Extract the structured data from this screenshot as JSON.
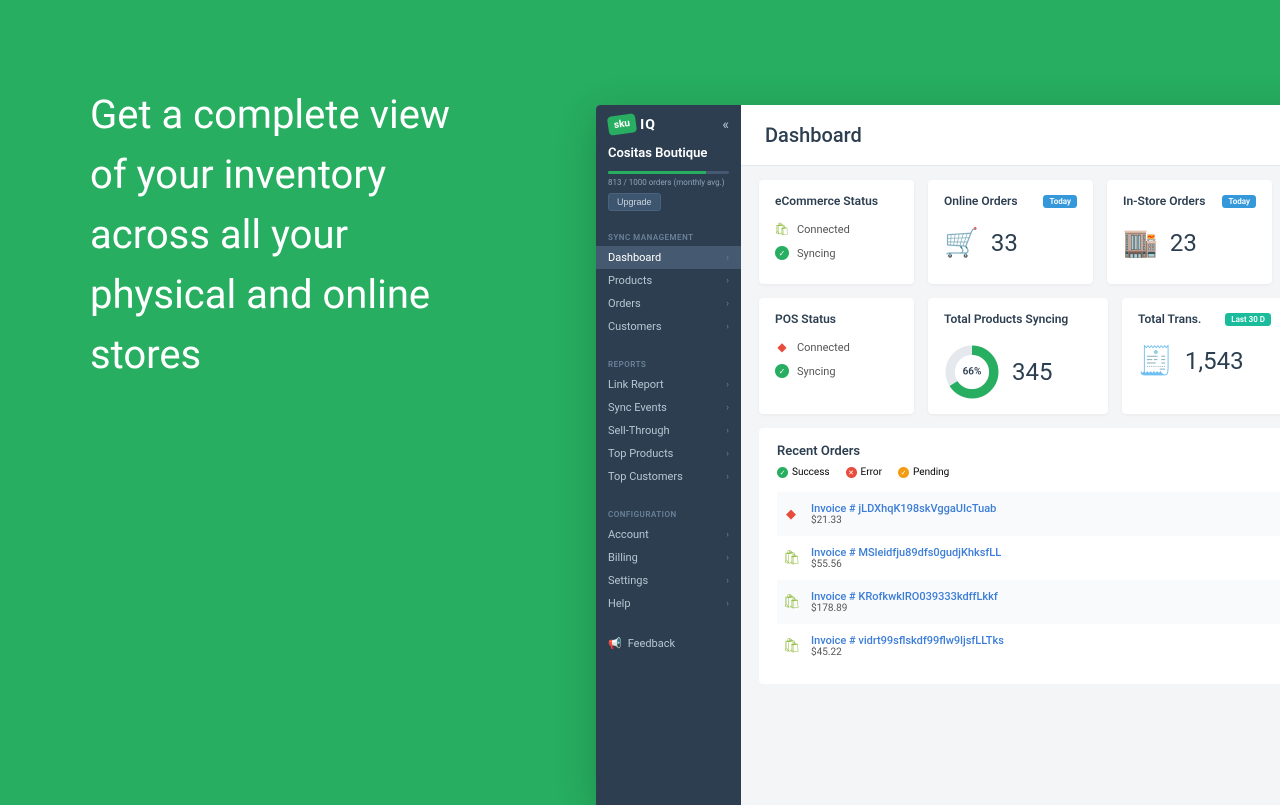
{
  "hero": "Get a complete view of your inventory across all your physical and online stores",
  "logo": {
    "badge": "sku",
    "iq": "IQ"
  },
  "store": {
    "name": "Cositas Boutique",
    "usage": "813 / 1000 orders (monthly avg.)",
    "usagePct": 81,
    "upgrade": "Upgrade"
  },
  "nav": {
    "sync": {
      "heading": "SYNC MANAGEMENT",
      "items": [
        "Dashboard",
        "Products",
        "Orders",
        "Customers"
      ]
    },
    "reports": {
      "heading": "REPORTS",
      "items": [
        "Link Report",
        "Sync Events",
        "Sell-Through",
        "Top Products",
        "Top Customers"
      ]
    },
    "config": {
      "heading": "CONFIGURATION",
      "items": [
        "Account",
        "Billing",
        "Settings",
        "Help"
      ]
    },
    "feedback": "Feedback"
  },
  "main": {
    "title": "Dashboard"
  },
  "cards": {
    "ecom": {
      "title": "eCommerce Status",
      "connected": "Connected",
      "syncing": "Syncing"
    },
    "pos": {
      "title": "POS Status",
      "connected": "Connected",
      "syncing": "Syncing"
    },
    "online": {
      "title": "Online Orders",
      "badge": "Today",
      "value": "33"
    },
    "instore": {
      "title": "In-Store Orders",
      "badge": "Today",
      "value": "23"
    },
    "products": {
      "title": "Total Products Syncing",
      "pct": "66%",
      "pctNum": 66,
      "value": "345"
    },
    "trans": {
      "title": "Total Trans.",
      "badge": "Last 30 D",
      "value": "1,543"
    }
  },
  "recent": {
    "title": "Recent Orders",
    "legend": {
      "success": "Success",
      "error": "Error",
      "pending": "Pending"
    },
    "orders": [
      {
        "source": "ls",
        "invoice": "Invoice # jLDXhqK198skVggaUIcTuab",
        "price": "$21.33"
      },
      {
        "source": "shop",
        "invoice": "Invoice # MSleidfju89dfs0gudjKhksfLL",
        "price": "$55.56"
      },
      {
        "source": "shop",
        "invoice": "Invoice # KRofkwklRO039333kdffLkkf",
        "price": "$178.89"
      },
      {
        "source": "shop",
        "invoice": "Invoice # vidrt99sflskdf99flw9ljsfLLTks",
        "price": "$45.22"
      }
    ]
  }
}
